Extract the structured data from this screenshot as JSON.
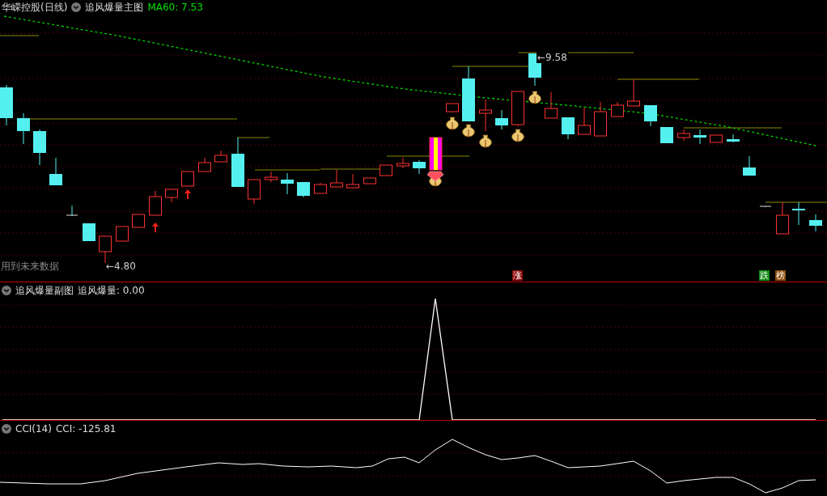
{
  "main_panel": {
    "stock_title": "华嵘控股(日线)",
    "indicator": "追风爆量主图",
    "ma_reading": "MA60: 7.53",
    "warning": "用到未来数据",
    "low_mark": "←4.80",
    "high_mark": "←9.58",
    "badges": [
      {
        "text": "涨",
        "color": "#8b0a0a"
      },
      {
        "text": "跌",
        "color": "#0f8a12"
      },
      {
        "text": "榜",
        "color": "#8b4a0a"
      }
    ]
  },
  "sub_panel": {
    "indicator": "追风爆量副图",
    "reading": "追风爆量: 0.00"
  },
  "cci_panel": {
    "indicator": "CCI(14)",
    "reading": "CCI: -125.81"
  }
}
